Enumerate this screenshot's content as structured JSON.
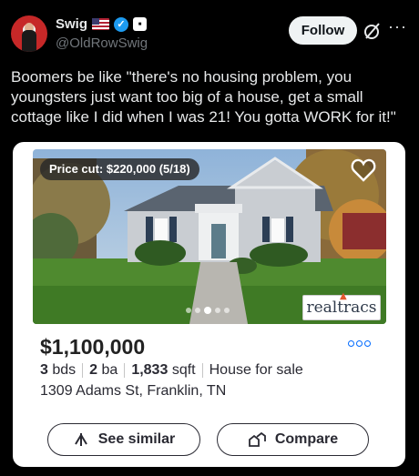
{
  "post": {
    "author_name": "Swig",
    "handle": "@OldRowSwig",
    "follow_label": "Follow",
    "more_label": "···",
    "text": "Boomers be like \"there's no housing problem, you youngsters just want too big of a house, get a small cottage like I did when I was 21!  You gotta WORK for it!\""
  },
  "listing": {
    "badge": "Price cut: $220,000 (5/18)",
    "price": "$1,100,000",
    "beds_value": "3",
    "beds_unit": "bds",
    "baths_value": "2",
    "baths_unit": "ba",
    "sqft_value": "1,833",
    "sqft_unit": "sqft",
    "type": "House for sale",
    "address": "1309 Adams St, Franklin, TN",
    "watermark": "realtracs",
    "photo_count": 5,
    "active_photo": 3,
    "see_similar_label": "See similar",
    "compare_label": "Compare"
  },
  "icons": [
    "flag-icon",
    "verified-icon",
    "affiliate-badge-icon",
    "grok-icon",
    "more-icon",
    "heart-icon",
    "more-dots-icon",
    "similar-icon",
    "compare-icon"
  ],
  "colors": {
    "background": "#000000",
    "follow_bg": "#eff3f4",
    "verified": "#1d9bf0",
    "link_blue": "#006aff",
    "card": "#ffffff"
  }
}
